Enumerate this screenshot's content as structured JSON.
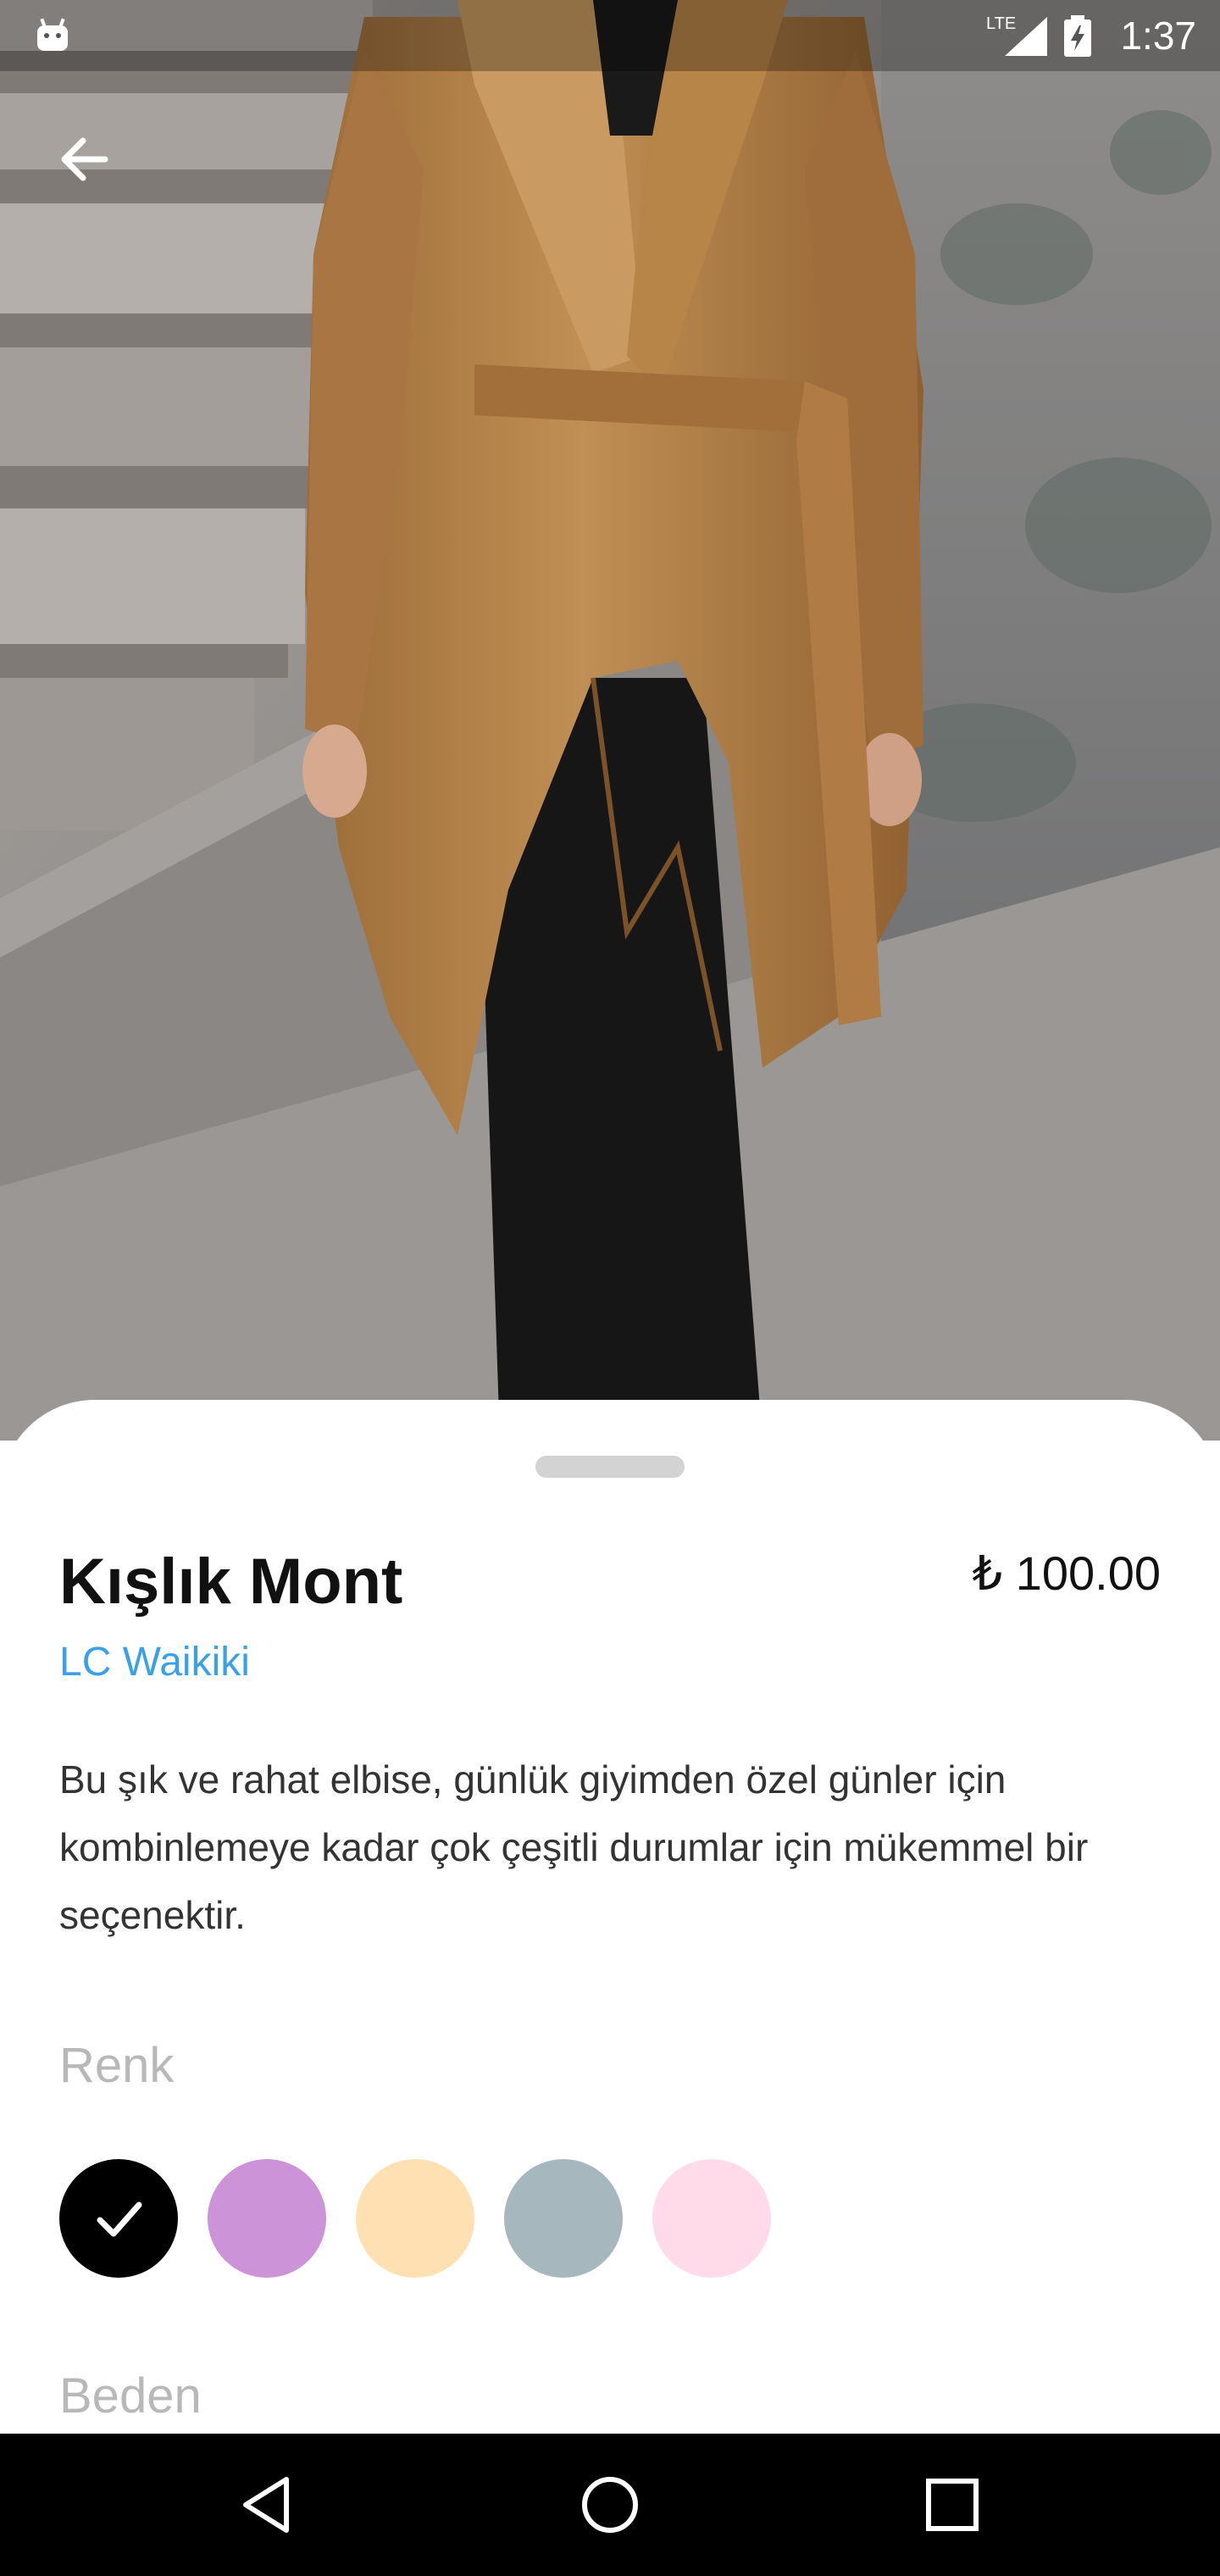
{
  "status_bar": {
    "time": "1:37",
    "network": "LTE",
    "icons": [
      "android-icon",
      "lte-signal-icon",
      "battery-charging-icon"
    ]
  },
  "header": {
    "back_icon": "arrow-left-icon"
  },
  "product": {
    "name": "Kışlık Mont",
    "price": "₺ 100.00",
    "brand": "LC Waikiki",
    "description": "Bu şık ve rahat elbise, günlük giyimden özel günler için kombinlemeye kadar çok çeşitli durumlar için mükemmel bir seçenektir."
  },
  "options": {
    "color_label": "Renk",
    "colors": [
      {
        "hex": "#000000",
        "selected": true
      },
      {
        "hex": "#cd93d8",
        "selected": false
      },
      {
        "hex": "#ffe0b2",
        "selected": false
      },
      {
        "hex": "#a7b7be",
        "selected": false
      },
      {
        "hex": "#ffdbea",
        "selected": false
      }
    ],
    "size_label": "Beden"
  },
  "nav_bar": {
    "icons": [
      "back-triangle-icon",
      "home-circle-icon",
      "recents-square-icon"
    ]
  },
  "colors": {
    "accent": "#3aa0e8",
    "coat": "#b5834a",
    "muted_label": "#b8b8b8"
  }
}
